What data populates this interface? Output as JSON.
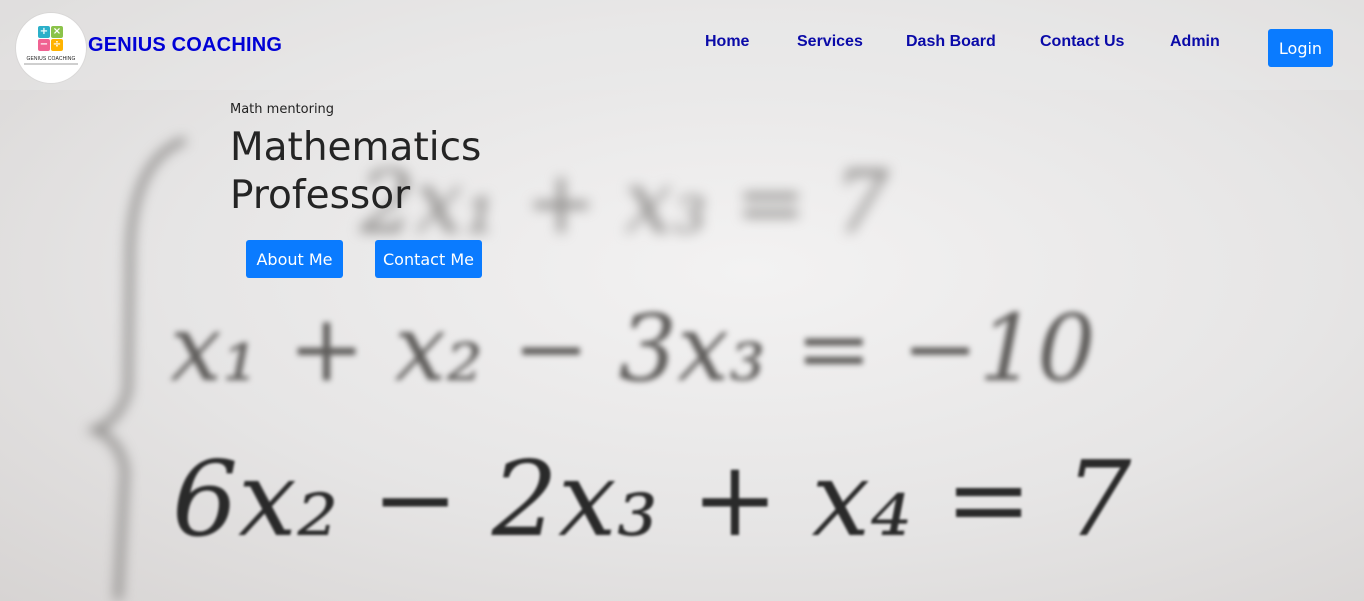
{
  "header": {
    "logo_caption": "GENIUS COACHING",
    "brand": "GENIUS COACHING",
    "nav": [
      {
        "label": "Home"
      },
      {
        "label": "Services"
      },
      {
        "label": "Dash Board"
      },
      {
        "label": "Contact Us"
      },
      {
        "label": "Admin"
      }
    ],
    "login_label": "Login"
  },
  "hero": {
    "eyebrow": "Math mentoring",
    "title_line1": "Mathematics",
    "title_line2": "Professor",
    "buttons": [
      {
        "label": "About Me"
      },
      {
        "label": "Contact Me"
      }
    ]
  },
  "background_equations": [
    "2x₁ + x₃ = 7",
    "x₁ + x₂ − 3x₃ = −10",
    "6x₂ − 2x₃ + x₄ = 7"
  ],
  "colors": {
    "brand": "#0000d6",
    "nav": "#0a0aa8",
    "button": "#0a7bff"
  }
}
